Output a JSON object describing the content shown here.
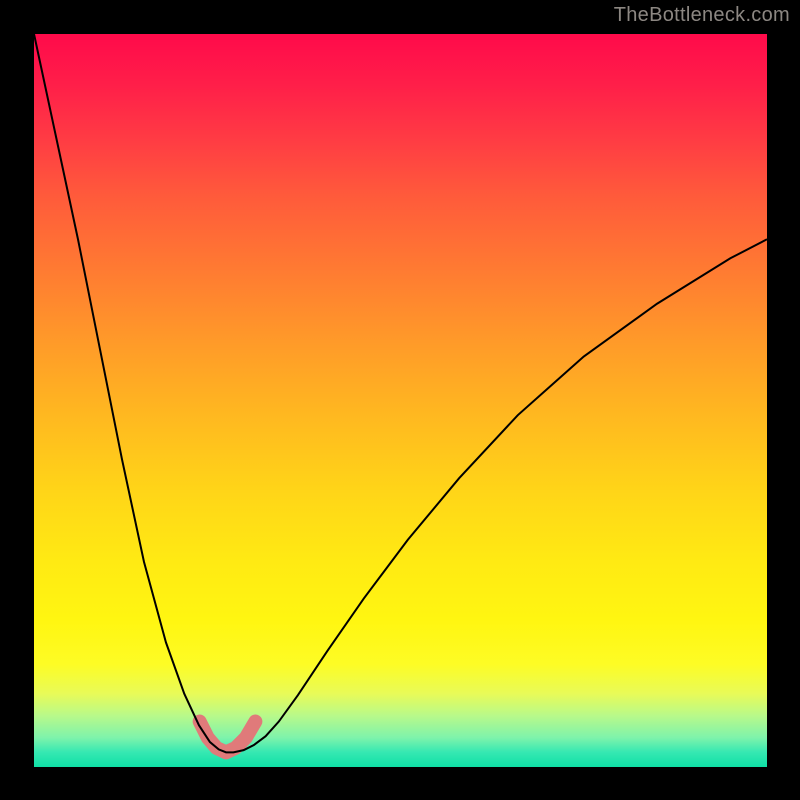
{
  "watermark": "TheBottleneck.com",
  "chart_data": {
    "type": "line",
    "title": "",
    "xlabel": "",
    "ylabel": "",
    "xlim": [
      0,
      1
    ],
    "ylim": [
      0,
      1
    ],
    "series": [
      {
        "name": "main-curve",
        "x": [
          0.0,
          0.03,
          0.06,
          0.09,
          0.12,
          0.15,
          0.18,
          0.205,
          0.225,
          0.24,
          0.252,
          0.262,
          0.272,
          0.286,
          0.3,
          0.316,
          0.334,
          0.36,
          0.4,
          0.45,
          0.51,
          0.58,
          0.66,
          0.75,
          0.85,
          0.95,
          1.0
        ],
        "y": [
          0.0,
          0.14,
          0.28,
          0.43,
          0.58,
          0.72,
          0.83,
          0.9,
          0.943,
          0.966,
          0.976,
          0.98,
          0.98,
          0.977,
          0.97,
          0.958,
          0.938,
          0.902,
          0.842,
          0.77,
          0.69,
          0.606,
          0.52,
          0.44,
          0.368,
          0.306,
          0.28
        ]
      },
      {
        "name": "near-bottom-segment",
        "x": [
          0.226,
          0.237,
          0.249,
          0.262,
          0.275,
          0.289,
          0.302
        ],
        "y": [
          0.938,
          0.96,
          0.974,
          0.98,
          0.974,
          0.96,
          0.938
        ]
      }
    ],
    "colors": {
      "top": "#ff0a4a",
      "mid": "#ffd418",
      "bottom": "#0fe0a6",
      "curve": "#000000",
      "short_curve": "#e07a7a",
      "frame": "#000000",
      "watermark": "#8c8782"
    }
  }
}
